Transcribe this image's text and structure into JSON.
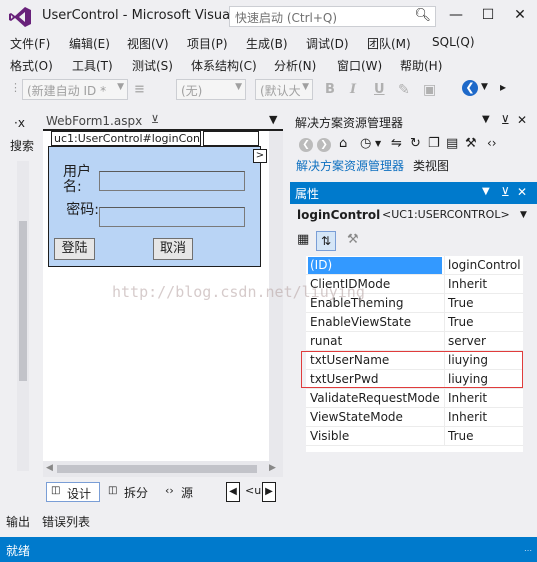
{
  "titlebar": {
    "title": "UserControl - Microsoft Visual...",
    "quick_launch_placeholder": "快速启动 (Ctrl+Q)"
  },
  "menu_row1": [
    "文件(F)",
    "编辑(E)",
    "视图(V)",
    "项目(P)",
    "生成(B)",
    "调试(D)",
    "团队(M)",
    "SQL(Q)"
  ],
  "menu_row2": [
    "格式(O)",
    "工具(T)",
    "测试(S)",
    "体系结构(C)",
    "分析(N)",
    "窗口(W)",
    "帮助(H)"
  ],
  "toolbar": {
    "block_format": "(新建自动 ID *",
    "font_name": "(无)",
    "font_size": "(默认大",
    "bold": "B",
    "italic": "I",
    "underline": "U"
  },
  "left_strip": {
    "label": "搜索"
  },
  "document": {
    "tab_label": "WebForm1.aspx",
    "control_label": "uc1:UserControl#loginControl",
    "username_label": "用户名:",
    "password_label": "密码:",
    "login_button": "登陆",
    "cancel_button": "取消",
    "smart_tag": ">"
  },
  "view_bar": {
    "design": "设计",
    "split": "拆分",
    "source": "源",
    "tag_nav": "<u"
  },
  "solution_explorer": {
    "title": "解决方案资源管理器",
    "tab_solution": "解决方案资源管理器",
    "tab_class": "类视图"
  },
  "properties": {
    "title": "属性",
    "object_name": "loginControl",
    "object_type": "<UC1:USERCONTROL>",
    "rows": [
      {
        "name": "(ID)",
        "value": "loginControl"
      },
      {
        "name": "ClientIDMode",
        "value": "Inherit"
      },
      {
        "name": "EnableTheming",
        "value": "True"
      },
      {
        "name": "EnableViewState",
        "value": "True"
      },
      {
        "name": "runat",
        "value": "server"
      },
      {
        "name": "txtUserName",
        "value": "liuying"
      },
      {
        "name": "txtUserPwd",
        "value": "liuying"
      },
      {
        "name": "ValidateRequestMode",
        "value": "Inherit"
      },
      {
        "name": "ViewStateMode",
        "value": "Inherit"
      },
      {
        "name": "Visible",
        "value": "True"
      }
    ],
    "highlight_color": "#e03c3c"
  },
  "bottom_tabs": [
    "输出",
    "错误列表"
  ],
  "status": {
    "text": "就绪"
  },
  "watermark": "http://blog.csdn.net/liuying",
  "colors": {
    "accent": "#007acc",
    "control_bg": "#b9d4f5",
    "selected_row": "#3399ff"
  }
}
